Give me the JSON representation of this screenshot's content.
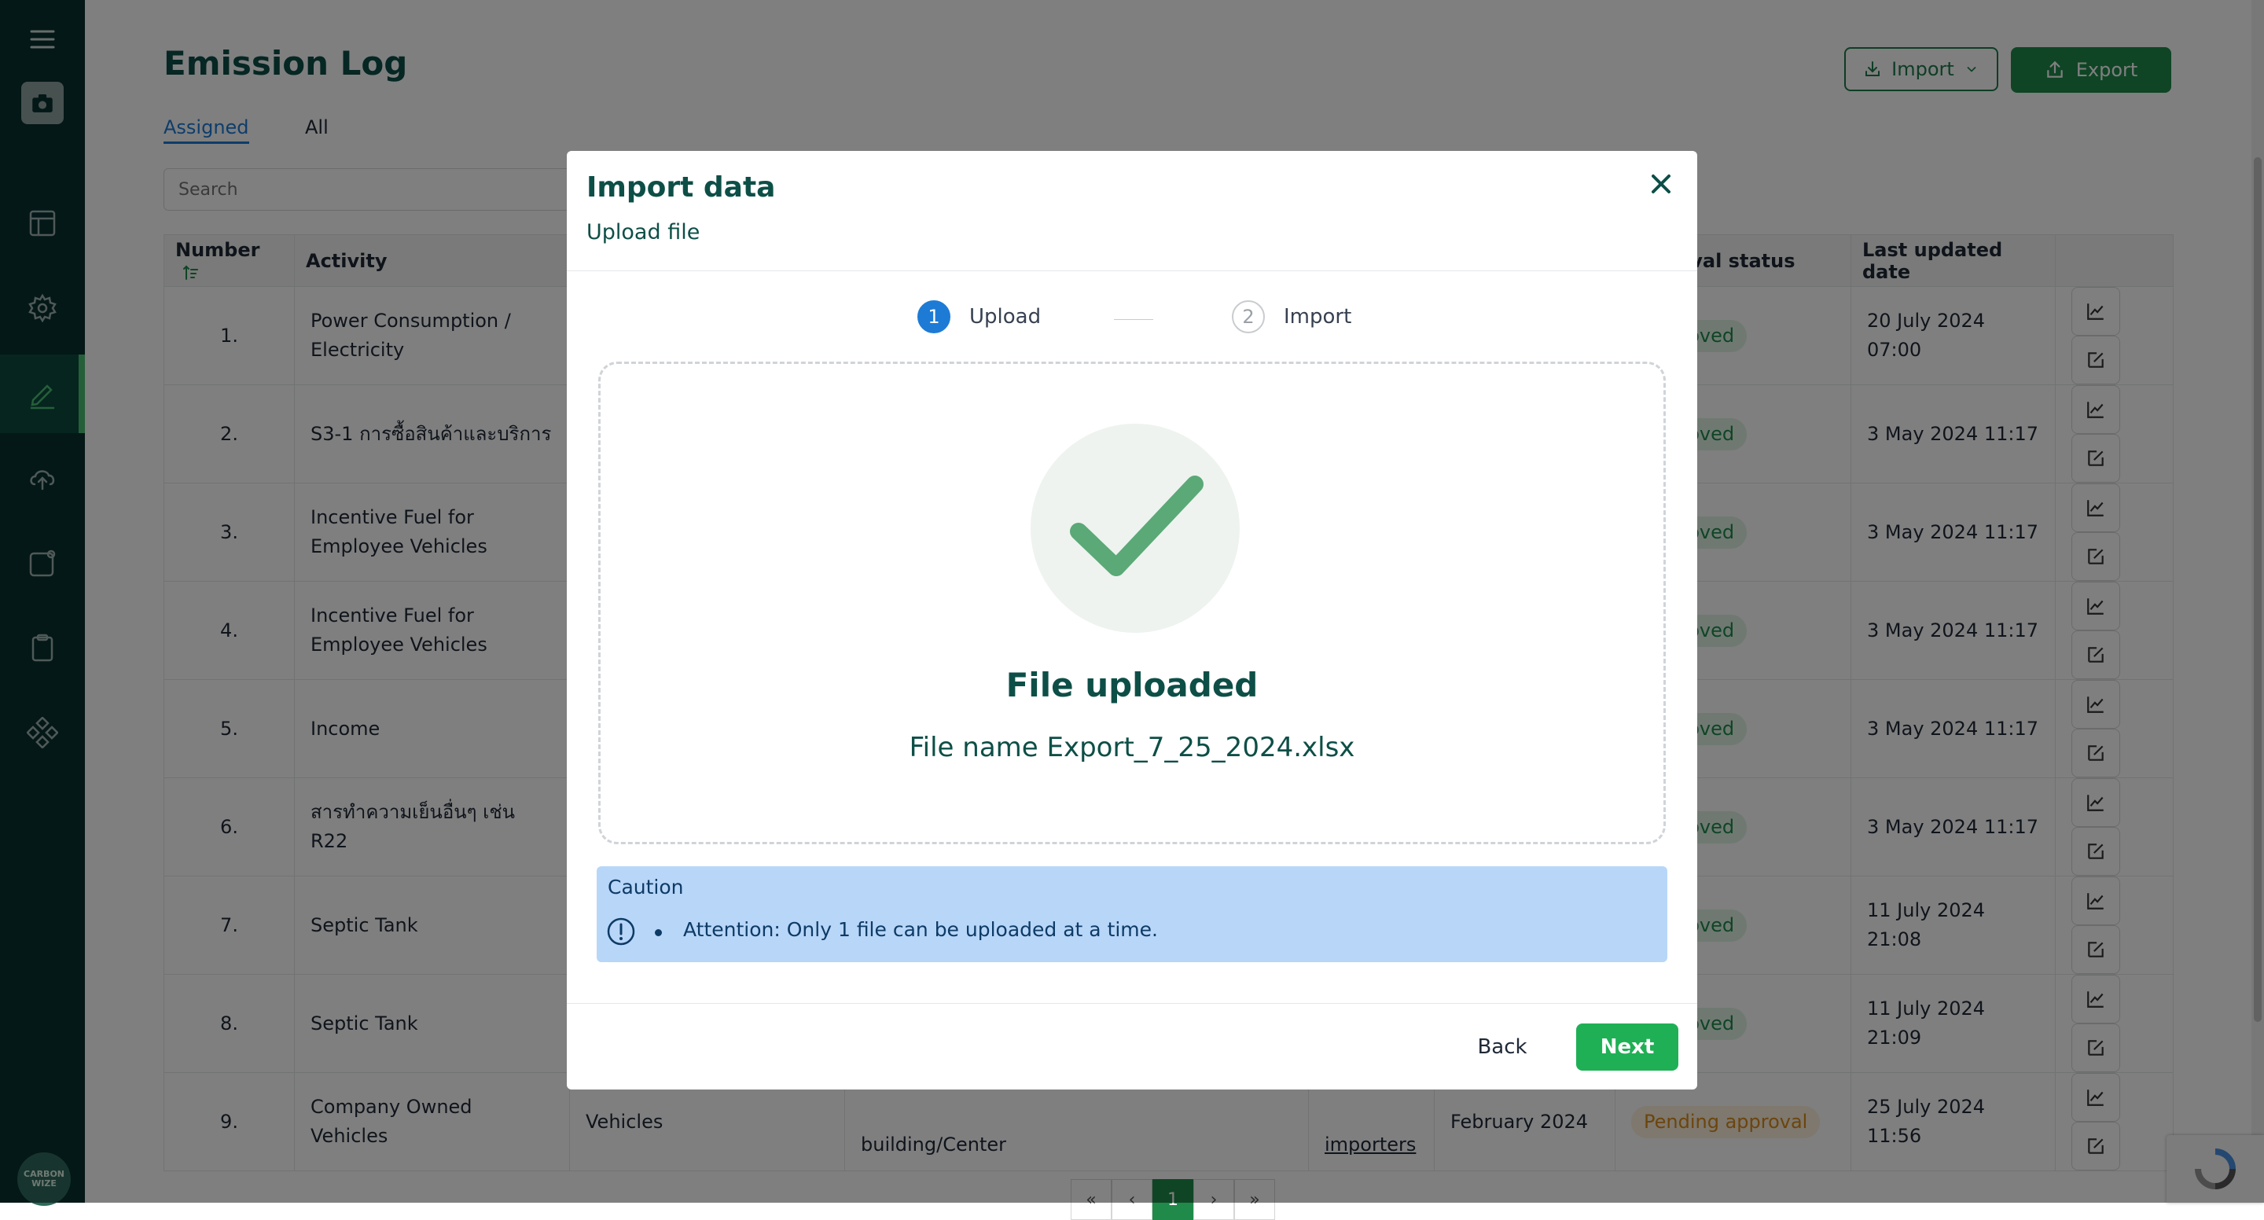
{
  "sidebar": {
    "logo_text": "CARBON WIZE",
    "items": [
      {
        "icon": "menu-icon"
      },
      {
        "icon": "camera-icon"
      },
      {
        "icon": "layout-icon"
      },
      {
        "icon": "gear-icon"
      },
      {
        "icon": "edit-icon",
        "active": true
      },
      {
        "icon": "cloud-upload-icon"
      },
      {
        "icon": "notification-card-icon"
      },
      {
        "icon": "clipboard-icon"
      },
      {
        "icon": "modules-icon"
      }
    ]
  },
  "header": {
    "title": "Emission Log",
    "import_label": "Import",
    "export_label": "Export"
  },
  "tabs": [
    {
      "label": "Assigned",
      "active": true
    },
    {
      "label": "All",
      "active": false
    }
  ],
  "search": {
    "placeholder": "Search"
  },
  "table": {
    "columns": {
      "number": "Number",
      "activity": "Activity",
      "approval_status": "Approval status",
      "last_updated": "Last updated date"
    },
    "rows": [
      {
        "num": "1.",
        "activity": "Power Consumption / Electricity",
        "status": "Approved",
        "updated": "20 July 2024 07:00"
      },
      {
        "num": "2.",
        "activity": "S3-1 การซื้อสินค้าและบริการ",
        "status": "Approved",
        "updated": "3 May 2024 11:17"
      },
      {
        "num": "3.",
        "activity": "Incentive Fuel for Employee Vehicles",
        "status": "Approved",
        "updated": "3 May 2024 11:17"
      },
      {
        "num": "4.",
        "activity": "Incentive Fuel for Employee Vehicles",
        "status": "Approved",
        "updated": "3 May 2024 11:17"
      },
      {
        "num": "5.",
        "activity": "Income",
        "status": "Approved",
        "updated": "3 May 2024 11:17"
      },
      {
        "num": "6.",
        "activity": "สารทำความเย็นอื่นๆ เช่น R22",
        "status": "Approved",
        "updated": "3 May 2024 11:17"
      },
      {
        "num": "7.",
        "activity": "Septic Tank",
        "status": "Approved",
        "updated": "11 July 2024 21:08"
      },
      {
        "num": "8.",
        "activity": "Septic Tank",
        "status": "Approved",
        "updated": "11 July 2024 21:09"
      },
      {
        "num": "9.",
        "activity": "Company Owned Vehicles",
        "col3": "Vehicles",
        "col4": "building/Center",
        "col5": "importers",
        "col6": "February 2024",
        "status": "Pending approval",
        "updated": "25 July 2024 11:56"
      }
    ]
  },
  "pagination": {
    "current": "1",
    "first": "«",
    "prev": "‹",
    "next": "›",
    "last": "»"
  },
  "modal": {
    "title": "Import data",
    "subtitle": "Upload file",
    "steps": [
      {
        "num": "1",
        "label": "Upload",
        "active": true
      },
      {
        "num": "2",
        "label": "Import",
        "active": false
      }
    ],
    "upload_status": "File uploaded",
    "file_name": "File name Export_7_25_2024.xlsx",
    "caution": {
      "title": "Caution",
      "message": "Attention: Only 1 file can be uploaded at a time."
    },
    "back_label": "Back",
    "next_label": "Next"
  },
  "colors": {
    "sidebar": "#06302f",
    "brand_green": "#1f8a4a",
    "next_button": "#1fb055",
    "title_teal": "#0d4f47",
    "step_active": "#1d7bd6",
    "caution_bg": "#b8d6f8"
  }
}
